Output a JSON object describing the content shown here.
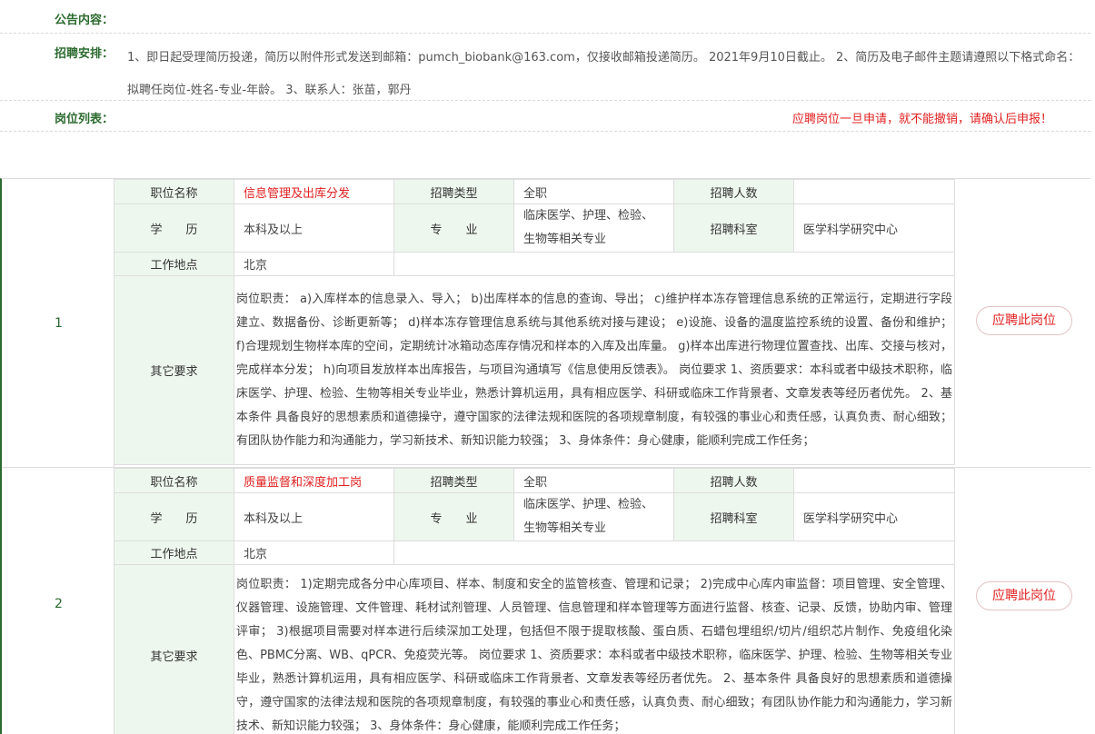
{
  "notice": {
    "content_label": "公告内容：",
    "arrangement_label": "招聘安排：",
    "arrangement_text": "1、即日起受理简历投递，简历以附件形式发送到邮箱：pumch_biobank@163.com，仅接收邮箱投递简历。 2021年9月10日截止。 2、简历及电子邮件主题请遵照以下格式命名：拟聘任岗位-姓名-专业-年龄。 3、联系人：张苗，郭丹",
    "positions_label": "岗位列表：",
    "warning": "应聘岗位一旦申请，就不能撤销，请确认后申报！"
  },
  "labels": {
    "position_name": "职位名称",
    "recruit_type": "招聘类型",
    "headcount": "招聘人数",
    "education": "学　　历",
    "major": "专　　业",
    "department": "招聘科室",
    "location": "工作地点",
    "other": "其它要求"
  },
  "jobs": [
    {
      "index": "1",
      "title": "信息管理及出库分发",
      "type": "全职",
      "headcount": "",
      "education": "本科及以上",
      "major": "临床医学、护理、检验、生物等相关专业",
      "department": "医学科学研究中心",
      "location": "北京",
      "requirements": "岗位职责： a)入库样本的信息录入、导入； b)出库样本的信息的查询、导出； c)维护样本冻存管理信息系统的正常运行，定期进行字段建立、数据备份、诊断更新等； d)样本冻存管理信息系统与其他系统对接与建设； e)设施、设备的温度监控系统的设置、备份和维护； f)合理规划生物样本库的空间，定期统计冰箱动态库存情况和样本的入库及出库量。 g)样本出库进行物理位置查找、出库、交接与核对，完成样本分发； h)向项目发放样本出库报告，与项目沟通填写《信息使用反馈表》。 岗位要求 1、资质要求：本科或者中级技术职称，临床医学、护理、检验、生物等相关专业毕业，熟悉计算机运用，具有相应医学、科研或临床工作背景者、文章发表等经历者优先。 2、基本条件 具备良好的思想素质和道德操守，遵守国家的法律法规和医院的各项规章制度，有较强的事业心和责任感，认真负责、耐心细致；有团队协作能力和沟通能力，学习新技术、新知识能力较强； 3、身体条件：身心健康，能顺利完成工作任务；",
      "apply": "应聘此岗位"
    },
    {
      "index": "2",
      "title": "质量监督和深度加工岗",
      "type": "全职",
      "headcount": "",
      "education": "本科及以上",
      "major": "临床医学、护理、检验、生物等相关专业",
      "department": "医学科学研究中心",
      "location": "北京",
      "requirements": "岗位职责： 1)定期完成各分中心库项目、样本、制度和安全的监管核查、管理和记录； 2)完成中心库内审监督：项目管理、安全管理、仪器管理、设施管理、文件管理、耗材试剂管理、人员管理、信息管理和样本管理等方面进行监督、核查、记录、反馈，协助内审、管理评审； 3)根据项目需要对样本进行后续深加工处理，包括但不限于提取核酸、蛋白质、石蜡包埋组织/切片/组织芯片制作、免疫组化染色、PBMC分离、WB、qPCR、免疫荧光等。 岗位要求 1、资质要求：本科或者中级技术职称，临床医学、护理、检验、生物等相关专业毕业，熟悉计算机运用，具有相应医学、科研或临床工作背景者、文章发表等经历者优先。 2、基本条件 具备良好的思想素质和道德操守，遵守国家的法律法规和医院的各项规章制度，有较强的事业心和责任感，认真负责、耐心细致；有团队协作能力和沟通能力，学习新技术、新知识能力较强； 3、身体条件：身心健康，能顺利完成工作任务；",
      "apply": "应聘此岗位"
    }
  ]
}
